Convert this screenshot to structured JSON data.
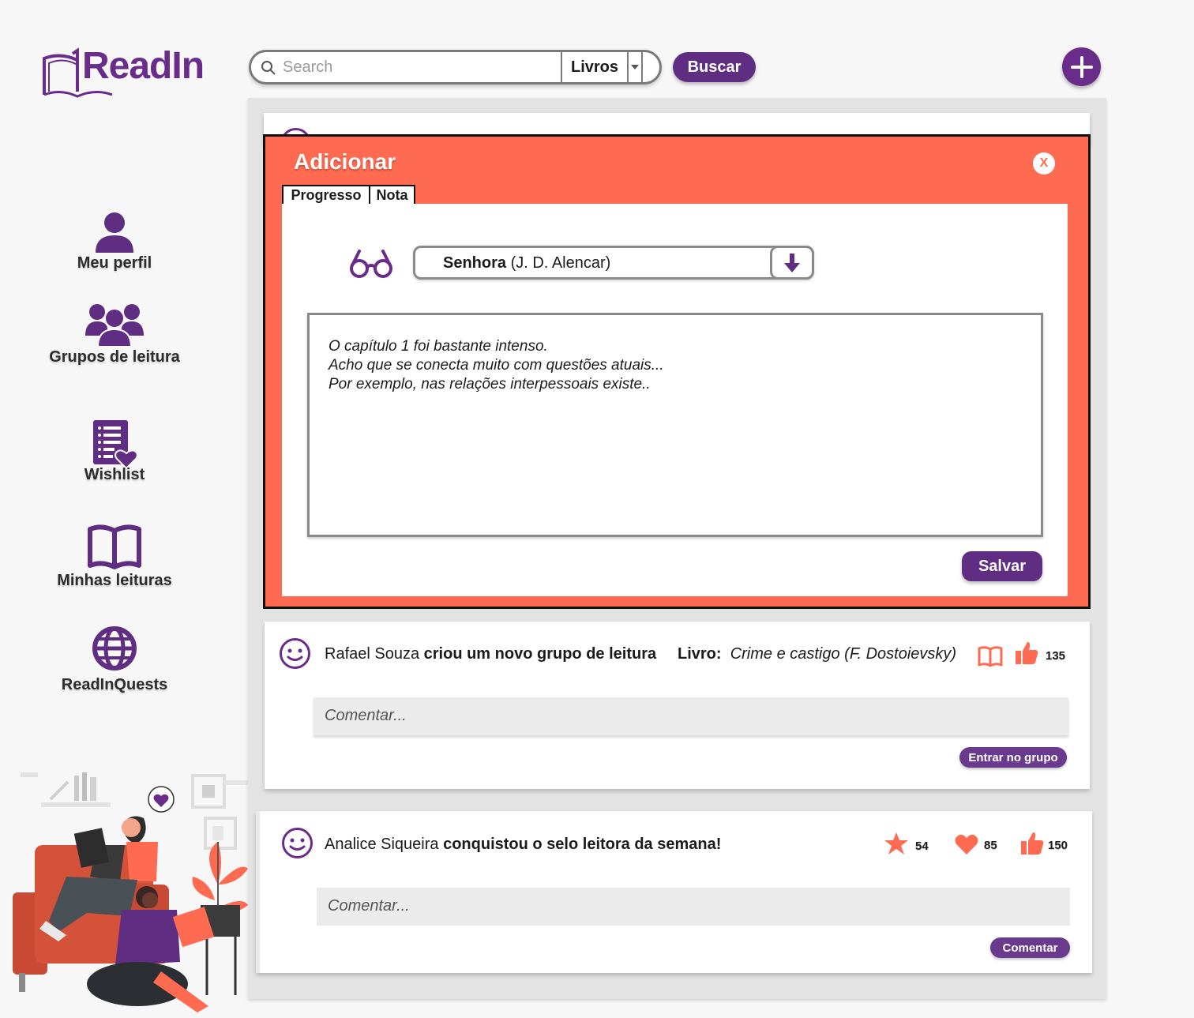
{
  "brand": {
    "name": "ReadIn"
  },
  "search": {
    "placeholder": "Search",
    "category": "Livros",
    "button_label": "Buscar"
  },
  "sidebar": {
    "items": [
      {
        "label": "Meu perfil",
        "icon": "user-icon"
      },
      {
        "label": "Grupos de leitura",
        "icon": "group-icon"
      },
      {
        "label": "Wishlist",
        "icon": "wishlist-icon"
      },
      {
        "label": "Minhas leituras",
        "icon": "open-book-icon"
      },
      {
        "label": "ReadInQuests",
        "icon": "globe-icon"
      }
    ]
  },
  "modal": {
    "title": "Adicionar",
    "close_label": "X",
    "tabs": [
      {
        "label": "Progresso"
      },
      {
        "label": "Nota"
      }
    ],
    "book": {
      "title": "Senhora",
      "author": "(J. D. Alencar)"
    },
    "note_lines": [
      "O capítulo 1 foi bastante intenso.",
      "Acho que se conecta muito com questões atuais...",
      "Por exemplo, nas relações interpessoais existe.."
    ],
    "save_label": "Salvar"
  },
  "posts": [
    {
      "user": "Rafael Souza",
      "action": "criou um novo grupo de leitura",
      "book_label": "Livro:",
      "book": "Crime e castigo (F. Dostoievsky)",
      "likes": "135",
      "comment_placeholder": "Comentar...",
      "button_label": "Entrar no grupo"
    },
    {
      "user": "Analice Siqueira",
      "action": "conquistou o selo leitora da semana!",
      "stars": "54",
      "hearts": "85",
      "likes": "150",
      "comment_placeholder": "Comentar...",
      "button_label": "Comentar"
    }
  ],
  "colors": {
    "purple": "#5f2d82",
    "accent": "#ff6b51",
    "panel": "#e3e3e3"
  }
}
